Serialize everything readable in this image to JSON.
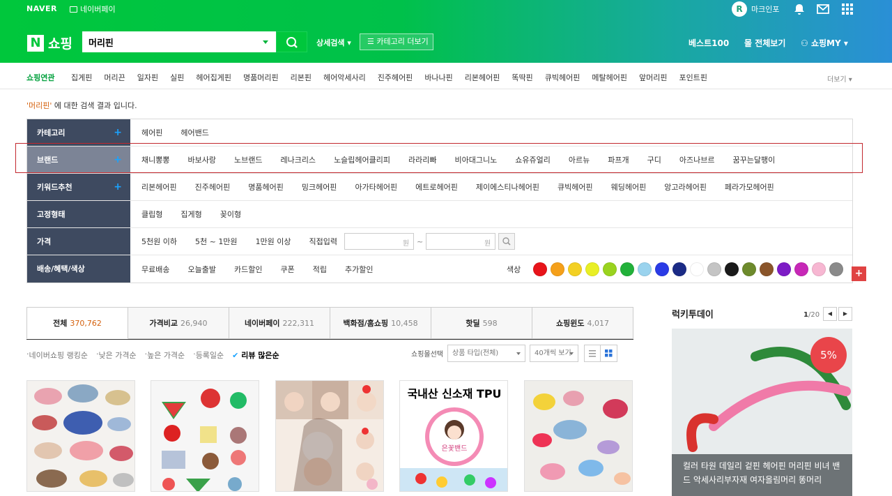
{
  "top": {
    "brand": "NAVER",
    "pay": "네이버페이",
    "markinfo": "마크인포"
  },
  "header": {
    "logo_n": "N",
    "logo_text": "쇼핑",
    "search_value": "머리핀",
    "detail": "상세검색",
    "catmore": "카테고리 더보기",
    "best": "베스트100",
    "mall": "몰 전체보기",
    "my": "쇼핑MY"
  },
  "related": {
    "label": "쇼핑연관",
    "items": [
      "집게핀",
      "머리끈",
      "일자핀",
      "실핀",
      "헤어집게핀",
      "명품머리핀",
      "리본핀",
      "헤어악세사리",
      "진주헤어핀",
      "바나나핀",
      "리본헤어핀",
      "똑딱핀",
      "큐빅헤어핀",
      "메탈헤어핀",
      "앞머리핀",
      "포인트핀"
    ],
    "more": "더보기"
  },
  "result": {
    "query": "'머리핀'",
    "text": " 에 대한 검색 결과 입니다."
  },
  "filters": {
    "category": {
      "label": "카테고리",
      "items": [
        "헤어핀",
        "헤어밴드"
      ]
    },
    "brand": {
      "label": "브랜드",
      "items": [
        "채니뽕뽕",
        "바보사랑",
        "노브랜드",
        "레나크리스",
        "노슬립헤어클리피",
        "라라리빠",
        "비아대그니노",
        "쇼유쥬얼리",
        "아르뉴",
        "파프개",
        "구디",
        "아즈나브르",
        "꿈꾸는달팽이"
      ]
    },
    "keyword": {
      "label": "키워드추천",
      "items": [
        "리본헤어핀",
        "진주헤어핀",
        "명품헤어핀",
        "밍크헤어핀",
        "아가타헤어핀",
        "에트로헤어핀",
        "제이에스티나헤어핀",
        "큐빅헤어핀",
        "웨딩헤어핀",
        "앙고라헤어핀",
        "페라가모헤어핀"
      ]
    },
    "fixed": {
      "label": "고정형태",
      "items": [
        "클립형",
        "집게형",
        "꽂이형"
      ]
    },
    "price": {
      "label": "가격",
      "items": [
        "5천원 이하",
        "5천 ~ 1만원",
        "1만원 이상",
        "직접입력"
      ],
      "unit": "원",
      "tilde": "~"
    },
    "delivery": {
      "label": "배송/혜택/색상",
      "items": [
        "무료배송",
        "오늘출발",
        "카드할인",
        "쿠폰",
        "적립",
        "추가할인"
      ],
      "color_label": "색상"
    }
  },
  "colors": [
    "#e8141a",
    "#f5a01a",
    "#f3d023",
    "#e9ef25",
    "#9ad31f",
    "#22b13a",
    "#9ad3ee",
    "#2a3be6",
    "#1b2b86",
    "#ffffff",
    "#c4c4c4",
    "#1a1a1a",
    "#6d8a2c",
    "#8a552a",
    "#7d1cc6",
    "#c728b7",
    "#f7b7d2",
    "#8a8a8a"
  ],
  "tabs": [
    {
      "label": "전체",
      "count": "370,762"
    },
    {
      "label": "가격비교",
      "count": "26,940"
    },
    {
      "label": "네이버페이",
      "count": "222,311"
    },
    {
      "label": "백화점/홈쇼핑",
      "count": "10,458"
    },
    {
      "label": "핫딜",
      "count": "598"
    },
    {
      "label": "쇼핑윈도",
      "count": "4,017"
    }
  ],
  "sort": {
    "items": [
      "네이버쇼핑 랭킹순",
      "낮은 가격순",
      "높은 가격순",
      "등록일순"
    ],
    "active": "리뷰 많은순"
  },
  "options": {
    "mall": "쇼핑몰선택",
    "type": "상품 타입(전체)",
    "count": "40개씩 보기"
  },
  "products": {
    "p4_text": "국내산 신소재 TPU",
    "p4_sub": "은꽃밴드"
  },
  "lucky": {
    "title": "럭키투데이",
    "page": "1",
    "total": "/20",
    "badge": "5%",
    "desc": "컬러 타원 데일리 겉핀 헤어핀 머리핀 비녀 밴드 악세사리부자재 여자올림머리 똥머리"
  }
}
